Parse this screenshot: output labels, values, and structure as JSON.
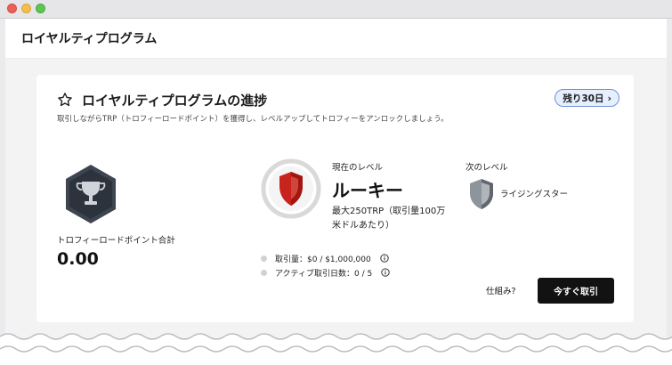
{
  "window": {
    "controls": [
      "close",
      "minimize",
      "maximize"
    ]
  },
  "header": {
    "title": "ロイヤルティプログラム"
  },
  "card": {
    "title": "ロイヤルティプログラムの進捗",
    "badge": {
      "label": "残り30日",
      "chevron": "›"
    },
    "subtitle": "取引しながらTRP（トロフィーロードポイント）を獲得し、レベルアップしてトロフィーをアンロックしましょう。",
    "points": {
      "label": "トロフィーロードポイント合計",
      "value": "0.00"
    },
    "current_level": {
      "label": "現在のレベル",
      "name": "ルーキー",
      "description": "最大250TRP（取引量100万米ドルあたり）"
    },
    "next_level": {
      "label": "次のレベル",
      "name": "ライジングスター"
    },
    "requirements": [
      {
        "text": "取引量：$0 / $1,000,000",
        "icon": "info-icon"
      },
      {
        "text": "アクティブ取引日数：0 / 5",
        "icon": "info-icon"
      }
    ],
    "how_link": "仕組み?",
    "trade_button": "今すぐ取引"
  },
  "colors": {
    "accent_badge_bg": "#e6effd",
    "accent_badge_border": "#6f93d9",
    "button_bg": "#121212",
    "shield_red": "#c9231d"
  },
  "icons": [
    "star-icon",
    "trophy-hex-icon",
    "rookie-shield-icon",
    "rising-star-shield-icon",
    "info-icon"
  ]
}
